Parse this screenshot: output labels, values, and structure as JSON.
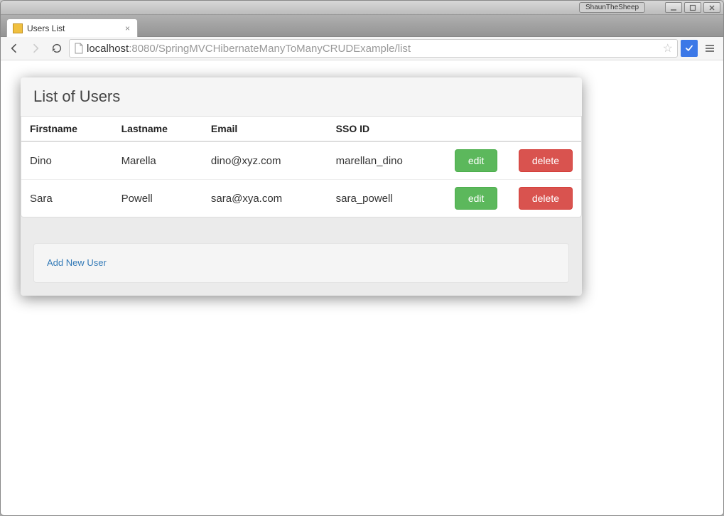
{
  "window": {
    "titlebar_label": "ShaunTheSheep"
  },
  "browser": {
    "tab_title": "Users List",
    "url_host": "localhost",
    "url_port_path": ":8080/SpringMVCHibernateManyToManyCRUDExample/list"
  },
  "page": {
    "header": "List of Users",
    "columns": {
      "firstname": "Firstname",
      "lastname": "Lastname",
      "email": "Email",
      "ssoid": "SSO ID"
    },
    "actions": {
      "edit": "edit",
      "delete": "delete"
    },
    "rows": [
      {
        "firstname": "Dino",
        "lastname": "Marella",
        "email": "dino@xyz.com",
        "ssoid": "marellan_dino"
      },
      {
        "firstname": "Sara",
        "lastname": "Powell",
        "email": "sara@xya.com",
        "ssoid": "sara_powell"
      }
    ],
    "add_link": "Add New User"
  }
}
